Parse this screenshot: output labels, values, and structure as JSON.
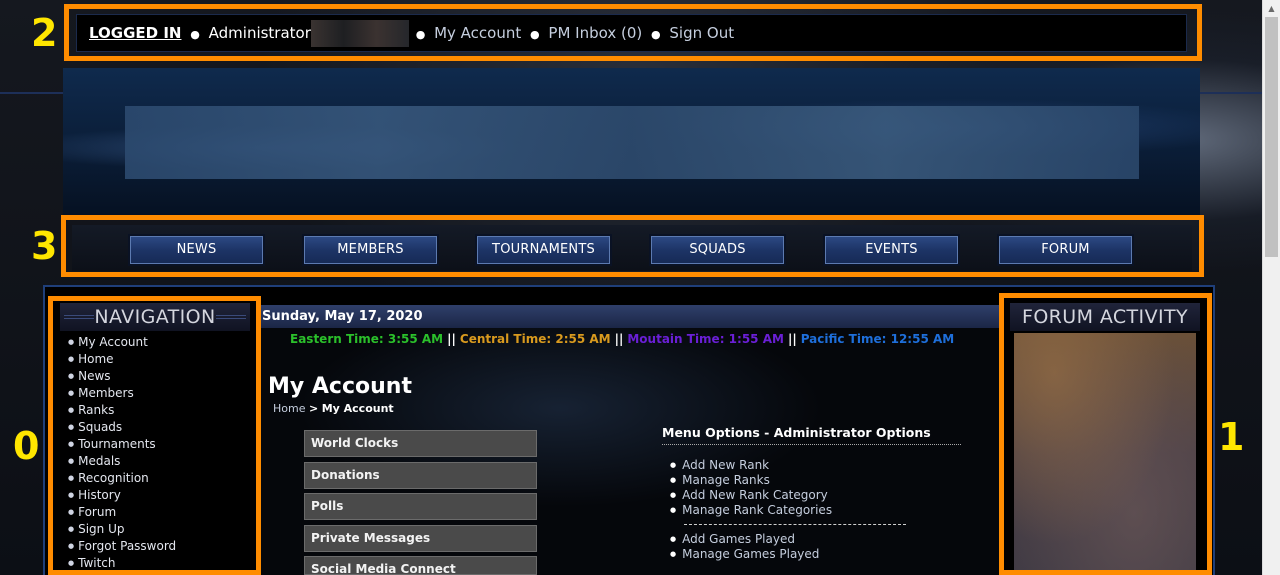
{
  "markers": [
    "2",
    "3",
    "0",
    "1"
  ],
  "topbar": {
    "logged_in": "LOGGED IN",
    "admin": "Administrator",
    "my_account": "My Account",
    "pm_inbox": "PM Inbox (0)",
    "sign_out": "Sign Out",
    "bullet": "●"
  },
  "nav_menu": [
    "NEWS",
    "MEMBERS",
    "TOURNAMENTS",
    "SQUADS",
    "EVENTS",
    "FORUM"
  ],
  "navigation": {
    "title": "NAVIGATION",
    "bullet": "●",
    "items": [
      "My Account",
      "Home",
      "News",
      "Members",
      "Ranks",
      "Squads",
      "Tournaments",
      "Medals",
      "Recognition",
      "History",
      "Forum",
      "Sign Up",
      "Forgot Password",
      "Twitch"
    ]
  },
  "date": "Sunday, May 17, 2020",
  "times": {
    "sep": "||",
    "eastern": {
      "label": "Eastern Time: 3:55 AM",
      "color": "#2bc02b"
    },
    "central": {
      "label": "Central Time: 2:55 AM",
      "color": "#d99a1e"
    },
    "mountain": {
      "label": "Moutain Time: 1:55 AM",
      "color": "#6a1fd6"
    },
    "pacific": {
      "label": "Pacific Time: 12:55 AM",
      "color": "#1e6fdb"
    }
  },
  "page": {
    "title": "My Account",
    "breadcrumb_home": "Home",
    "breadcrumb_sep": ">",
    "breadcrumb_current": "My Account"
  },
  "account_menu": [
    "World Clocks",
    "Donations",
    "Polls",
    "Private Messages",
    "Social Media Connect"
  ],
  "menu_options": {
    "title": "Menu Options - Administrator Options",
    "bullet": "●",
    "group1": [
      "Add New Rank",
      "Manage Ranks",
      "Add New Rank Category",
      "Manage Rank Categories"
    ],
    "group2": [
      "Add Games Played",
      "Manage Games Played"
    ]
  },
  "forum_activity": {
    "title": "FORUM ACTIVITY"
  },
  "colors": {
    "highlight": "#ff8c00",
    "marker": "#ffe600"
  }
}
